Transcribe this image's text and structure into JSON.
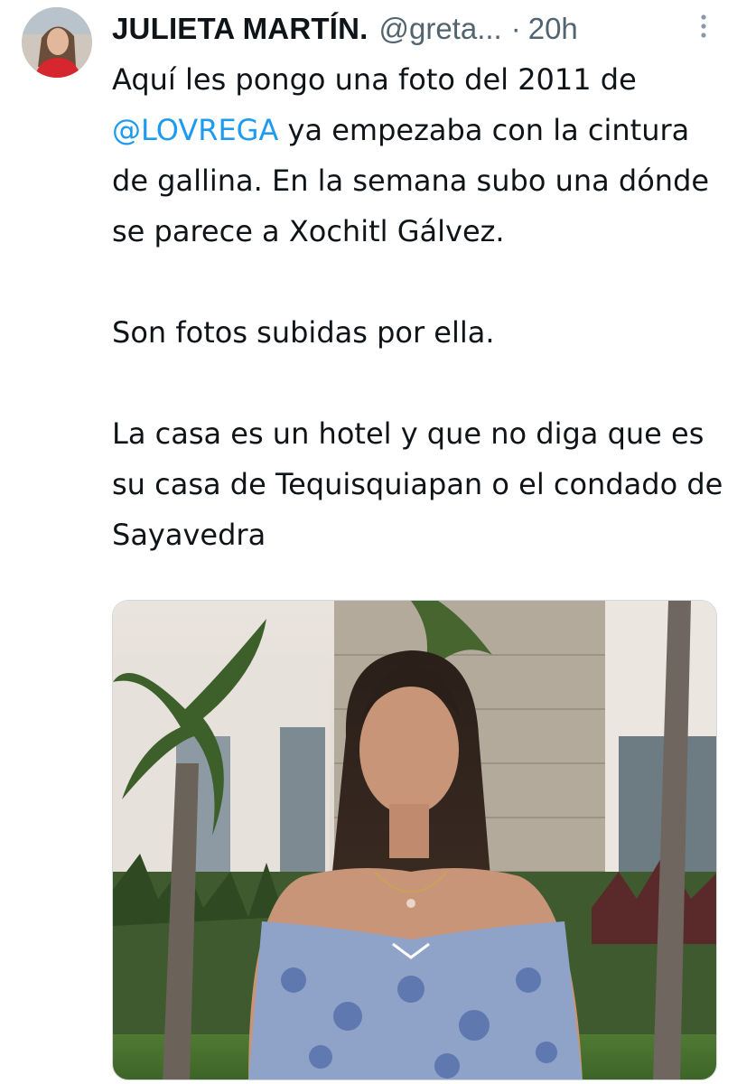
{
  "tweet": {
    "author": {
      "display_name": "JULIETA MARTÍN.",
      "handle": "@greta...",
      "separator": "·",
      "time": "20h"
    },
    "more_icon": "three-dots-vertical-icon",
    "text": {
      "line1": "Aquí les pongo una foto del 2011 de",
      "mention": "@LOVREGA",
      "after_mention": " ya empezaba con la cintura de gallina. En la semana subo una dónde se parece a Xochitl Gálvez.",
      "para2": "Son fotos subidas por ella.",
      "para3": "La casa es un hotel y que no diga que es su casa de Tequisquiapan o el condado de Sayavedra"
    },
    "colors": {
      "text": "#0f1419",
      "secondary": "#536471",
      "link": "#1d9bf0"
    }
  }
}
